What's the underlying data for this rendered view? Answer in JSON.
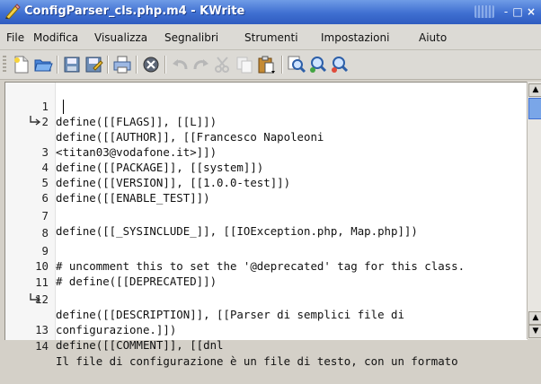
{
  "window": {
    "title": "ConfigParser_cls.php.m4 - KWrite",
    "controls": [
      "-",
      "□",
      "×"
    ]
  },
  "menubar": {
    "items": [
      "File",
      "Modifica",
      "Visualizza",
      "Segnalibri",
      "Strumenti",
      "Impostazioni",
      "Aiuto"
    ]
  },
  "toolbar": {
    "buttons": [
      "new-document-icon",
      "open-folder-icon",
      "save-icon",
      "save-as-icon",
      "print-icon",
      "close-document-icon",
      "undo-icon",
      "redo-icon",
      "cut-icon",
      "copy-icon",
      "paste-icon",
      "find-icon",
      "find-next-icon",
      "find-previous-icon"
    ]
  },
  "editor": {
    "lines": [
      {
        "num": "1",
        "text": "define([[FLAGS]], [[L]])"
      },
      {
        "num": "2",
        "text": "define([[AUTHOR]], [[Francesco Napoleoni"
      },
      {
        "num": "",
        "text": "<titan03@vodafone.it>]])",
        "wrapped": true
      },
      {
        "num": "3",
        "text": "define([[PACKAGE]], [[system]])"
      },
      {
        "num": "4",
        "text": "define([[VERSION]], [[1.0.0-test]])"
      },
      {
        "num": "5",
        "text": "define([[ENABLE_TEST]])"
      },
      {
        "num": "6",
        "text": ""
      },
      {
        "num": "7",
        "text": "define([[_SYSINCLUDE_]], [[IOException.php, Map.php]])"
      },
      {
        "num": "8",
        "text": ""
      },
      {
        "num": "9",
        "text": "# uncomment this to set the '@deprecated' tag for this class."
      },
      {
        "num": "10",
        "text": "# define([[DEPRECATED]])"
      },
      {
        "num": "11",
        "text": ""
      },
      {
        "num": "12",
        "text": "define([[DESCRIPTION]], [[Parser di semplici file di"
      },
      {
        "num": "",
        "text": "configurazione.]])",
        "wrapped": true
      },
      {
        "num": "13",
        "text": "define([[COMMENT]], [[dnl"
      },
      {
        "num": "14",
        "text": "Il file di configurazione è un file di testo, con un formato"
      }
    ]
  },
  "colors": {
    "titlebar": "#3f6fd1",
    "menubar": "#dcdad5",
    "editor_bg": "#ffffff"
  }
}
